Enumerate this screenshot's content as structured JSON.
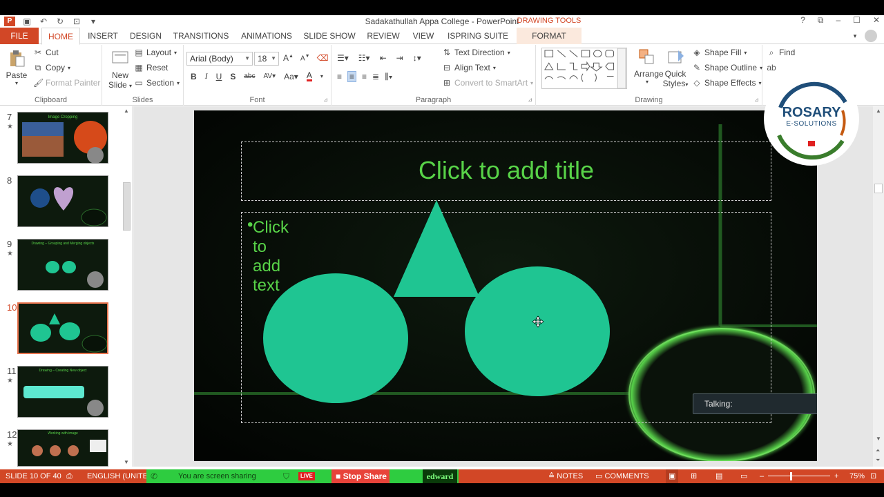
{
  "window": {
    "title": "Sadakathullah Appa College - PowerPoint",
    "contextual_tab_header": "DRAWING TOOLS",
    "controls": [
      "?",
      "⧉",
      "–",
      "☐",
      "✕"
    ]
  },
  "tabs": [
    "FILE",
    "HOME",
    "INSERT",
    "DESIGN",
    "TRANSITIONS",
    "ANIMATIONS",
    "SLIDE SHOW",
    "REVIEW",
    "VIEW",
    "ISPRING SUITE 9",
    "FORMAT"
  ],
  "ribbon": {
    "clipboard": {
      "label": "Clipboard",
      "paste": "Paste",
      "cut": "Cut",
      "copy": "Copy",
      "format_painter": "Format Painter"
    },
    "slides": {
      "label": "Slides",
      "new_slide_1": "New",
      "new_slide_2": "Slide",
      "layout": "Layout",
      "reset": "Reset",
      "section": "Section"
    },
    "font": {
      "label": "Font",
      "family": "Arial (Body)",
      "size": "18"
    },
    "paragraph": {
      "label": "Paragraph",
      "text_direction": "Text Direction",
      "align_text": "Align Text",
      "convert_smartart": "Convert to SmartArt"
    },
    "drawing": {
      "label": "Drawing",
      "arrange": "Arrange",
      "quick_styles_1": "Quick",
      "quick_styles_2": "Styles",
      "shape_fill": "Shape Fill",
      "shape_outline": "Shape Outline",
      "shape_effects": "Shape Effects"
    },
    "editing": {
      "find": "Find"
    }
  },
  "logo": {
    "name": "ROSARY",
    "sub": "E-SOLUTIONS"
  },
  "thumbnails": [
    {
      "num": "7",
      "star": "★",
      "caption": "Image Cropping"
    },
    {
      "num": "8",
      "star": "",
      "caption": ""
    },
    {
      "num": "9",
      "star": "★",
      "caption": "Drawing – Grouping and Merging objects"
    },
    {
      "num": "10",
      "star": "",
      "caption": ""
    },
    {
      "num": "11",
      "star": "★",
      "caption": "Drawing – Creating New object"
    },
    {
      "num": "12",
      "star": "★",
      "caption": "Working with image"
    }
  ],
  "slide": {
    "title_placeholder": "Click to add title",
    "body_placeholder": "Click to add text",
    "shape_color": "#1fc592"
  },
  "overlay": {
    "talking": "Talking:"
  },
  "status": {
    "slide_info": "SLIDE 10 OF 40",
    "language": "ENGLISH (UNITED",
    "sharing": "You are screen sharing",
    "live": "LIVE",
    "stop_share": "Stop Share",
    "user": "edward",
    "notes": "NOTES",
    "comments": "COMMENTS",
    "zoom": "75%"
  },
  "colors": {
    "accent": "#d24726",
    "slide_text": "#58d348",
    "share_green": "#2ecc40"
  }
}
